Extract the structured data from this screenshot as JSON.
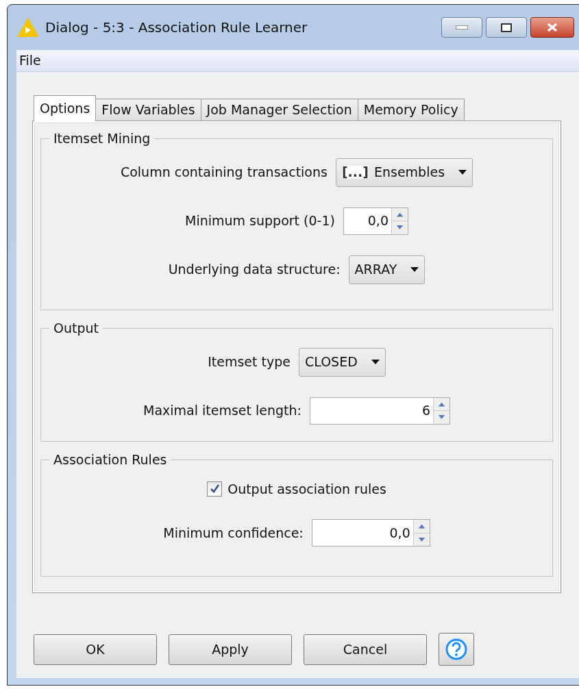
{
  "window": {
    "title": "Dialog - 5:3 - Association Rule Learner"
  },
  "menu": [
    "File"
  ],
  "tabs": [
    {
      "label": "Options",
      "selected": true
    },
    {
      "label": "Flow Variables",
      "selected": false
    },
    {
      "label": "Job Manager Selection",
      "selected": false
    },
    {
      "label": "Memory Policy",
      "selected": false
    }
  ],
  "groups": [
    {
      "title": "Itemset Mining",
      "rows": [
        {
          "kind": "select",
          "label": "Column containing transactions",
          "type_icon": "[...]",
          "value": "Ensembles"
        },
        {
          "kind": "spinner",
          "label": "Minimum support (0-1)",
          "value": "0,0"
        },
        {
          "kind": "select",
          "label": "Underlying data structure:",
          "value": "ARRAY"
        }
      ]
    },
    {
      "title": "Output",
      "rows": [
        {
          "kind": "select",
          "label": "Itemset type",
          "value": "CLOSED"
        },
        {
          "kind": "spinner",
          "label": "Maximal itemset length:",
          "value": "6"
        }
      ]
    },
    {
      "title": "Association Rules",
      "rows": [
        {
          "kind": "checkbox",
          "label": "Output association rules",
          "checked": true
        },
        {
          "kind": "spinner",
          "label": "Minimum confidence:",
          "value": "0,0"
        }
      ]
    }
  ],
  "buttons": [
    "OK",
    "Apply",
    "Cancel"
  ]
}
